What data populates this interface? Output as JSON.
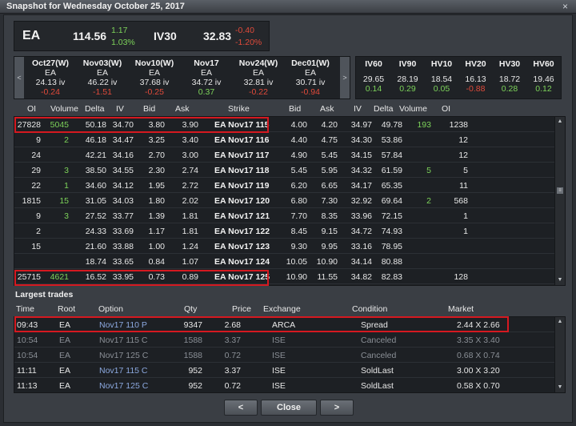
{
  "window": {
    "title": "Snapshot for Wednesday October 25, 2017",
    "close_glyph": "×"
  },
  "quote": {
    "symbol": "EA",
    "price": "114.56",
    "change": "1.17",
    "change_pct": "1.03%",
    "iv_label": "IV30",
    "iv_value": "32.83",
    "iv_change": "-0.40",
    "iv_change_pct": "-1.20%"
  },
  "expirations": {
    "left_arrow": "<",
    "right_arrow": ">",
    "items": [
      {
        "label": "Oct27(W)",
        "root": "EA",
        "iv": "24.13 iv",
        "change": "-0.24",
        "dir": "down"
      },
      {
        "label": "Nov03(W)",
        "root": "EA",
        "iv": "46.22 iv",
        "change": "-1.51",
        "dir": "down"
      },
      {
        "label": "Nov10(W)",
        "root": "EA",
        "iv": "37.68 iv",
        "change": "-0.25",
        "dir": "down"
      },
      {
        "label": "Nov17",
        "root": "EA",
        "iv": "34.72 iv",
        "change": "0.37",
        "dir": "up"
      },
      {
        "label": "Nov24(W)",
        "root": "EA",
        "iv": "32.81 iv",
        "change": "-0.22",
        "dir": "down"
      },
      {
        "label": "Dec01(W)",
        "root": "EA",
        "iv": "30.71 iv",
        "change": "-0.94",
        "dir": "down"
      }
    ]
  },
  "volatility": {
    "items": [
      {
        "label": "IV60",
        "value": "29.65",
        "change": "0.14",
        "dir": "up"
      },
      {
        "label": "IV90",
        "value": "28.19",
        "change": "0.29",
        "dir": "up"
      },
      {
        "label": "HV10",
        "value": "18.54",
        "change": "0.05",
        "dir": "up"
      },
      {
        "label": "HV20",
        "value": "16.13",
        "change": "-0.88",
        "dir": "down"
      },
      {
        "label": "HV30",
        "value": "18.72",
        "change": "0.28",
        "dir": "up"
      },
      {
        "label": "HV60",
        "value": "19.46",
        "change": "0.12",
        "dir": "up"
      }
    ]
  },
  "chain": {
    "headers": {
      "call_oi": "OI",
      "call_volume": "Volume",
      "call_delta": "Delta",
      "call_iv": "IV",
      "call_bid": "Bid",
      "call_ask": "Ask",
      "strike": "Strike",
      "put_bid": "Bid",
      "put_ask": "Ask",
      "put_iv": "IV",
      "put_delta": "Delta",
      "put_volume": "Volume",
      "put_oi": "OI"
    },
    "rows": [
      {
        "c_oi": "27828",
        "c_vol": "5045",
        "c_delta": "50.18",
        "c_iv": "34.70",
        "c_bid": "3.80",
        "c_ask": "3.90",
        "strike": "EA Nov17 115",
        "p_bid": "4.00",
        "p_ask": "4.20",
        "p_iv": "34.97",
        "p_delta": "49.78",
        "p_vol": "193",
        "p_oi": "1238"
      },
      {
        "c_oi": "9",
        "c_vol": "2",
        "c_delta": "46.18",
        "c_iv": "34.47",
        "c_bid": "3.25",
        "c_ask": "3.40",
        "strike": "EA Nov17 116",
        "p_bid": "4.40",
        "p_ask": "4.75",
        "p_iv": "34.30",
        "p_delta": "53.86",
        "p_vol": "",
        "p_oi": "12"
      },
      {
        "c_oi": "24",
        "c_vol": "",
        "c_delta": "42.21",
        "c_iv": "34.16",
        "c_bid": "2.70",
        "c_ask": "3.00",
        "strike": "EA Nov17 117",
        "p_bid": "4.90",
        "p_ask": "5.45",
        "p_iv": "34.15",
        "p_delta": "57.84",
        "p_vol": "",
        "p_oi": "12"
      },
      {
        "c_oi": "29",
        "c_vol": "3",
        "c_delta": "38.50",
        "c_iv": "34.55",
        "c_bid": "2.30",
        "c_ask": "2.74",
        "strike": "EA Nov17 118",
        "p_bid": "5.45",
        "p_ask": "5.95",
        "p_iv": "34.32",
        "p_delta": "61.59",
        "p_vol": "5",
        "p_oi": "5"
      },
      {
        "c_oi": "22",
        "c_vol": "1",
        "c_delta": "34.60",
        "c_iv": "34.12",
        "c_bid": "1.95",
        "c_ask": "2.72",
        "strike": "EA Nov17 119",
        "p_bid": "6.20",
        "p_ask": "6.65",
        "p_iv": "34.17",
        "p_delta": "65.35",
        "p_vol": "",
        "p_oi": "11"
      },
      {
        "c_oi": "1815",
        "c_vol": "15",
        "c_delta": "31.05",
        "c_iv": "34.03",
        "c_bid": "1.80",
        "c_ask": "2.02",
        "strike": "EA Nov17 120",
        "p_bid": "6.80",
        "p_ask": "7.30",
        "p_iv": "32.92",
        "p_delta": "69.64",
        "p_vol": "2",
        "p_oi": "568"
      },
      {
        "c_oi": "9",
        "c_vol": "3",
        "c_delta": "27.52",
        "c_iv": "33.77",
        "c_bid": "1.39",
        "c_ask": "1.81",
        "strike": "EA Nov17 121",
        "p_bid": "7.70",
        "p_ask": "8.35",
        "p_iv": "33.96",
        "p_delta": "72.15",
        "p_vol": "",
        "p_oi": "1"
      },
      {
        "c_oi": "2",
        "c_vol": "",
        "c_delta": "24.33",
        "c_iv": "33.69",
        "c_bid": "1.17",
        "c_ask": "1.81",
        "strike": "EA Nov17 122",
        "p_bid": "8.45",
        "p_ask": "9.15",
        "p_iv": "34.72",
        "p_delta": "74.93",
        "p_vol": "",
        "p_oi": "1"
      },
      {
        "c_oi": "15",
        "c_vol": "",
        "c_delta": "21.60",
        "c_iv": "33.88",
        "c_bid": "1.00",
        "c_ask": "1.24",
        "strike": "EA Nov17 123",
        "p_bid": "9.30",
        "p_ask": "9.95",
        "p_iv": "33.16",
        "p_delta": "78.95",
        "p_vol": "",
        "p_oi": ""
      },
      {
        "c_oi": "",
        "c_vol": "",
        "c_delta": "18.74",
        "c_iv": "33.65",
        "c_bid": "0.84",
        "c_ask": "1.07",
        "strike": "EA Nov17 124",
        "p_bid": "10.05",
        "p_ask": "10.90",
        "p_iv": "34.14",
        "p_delta": "80.88",
        "p_vol": "",
        "p_oi": ""
      },
      {
        "c_oi": "25715",
        "c_vol": "4621",
        "c_delta": "16.52",
        "c_iv": "33.95",
        "c_bid": "0.73",
        "c_ask": "0.89",
        "strike": "EA Nov17 125",
        "p_bid": "10.90",
        "p_ask": "11.55",
        "p_iv": "34.82",
        "p_delta": "82.83",
        "p_vol": "",
        "p_oi": "128"
      }
    ]
  },
  "trades": {
    "section_title": "Largest trades",
    "headers": {
      "time": "Time",
      "root": "Root",
      "option": "Option",
      "qty": "Qty",
      "price": "Price",
      "exchange": "Exchange",
      "condition": "Condition",
      "market": "Market"
    },
    "rows": [
      {
        "time": "09:43",
        "root": "EA",
        "option": "Nov17 110 P",
        "qty": "9347",
        "price": "2.68",
        "exchange": "ARCA",
        "condition": "Spread",
        "market": "2.44 X 2.66",
        "dim": false
      },
      {
        "time": "10:54",
        "root": "EA",
        "option": "Nov17 115 C",
        "qty": "1588",
        "price": "3.37",
        "exchange": "ISE",
        "condition": "Canceled",
        "market": "3.35 X 3.40",
        "dim": true
      },
      {
        "time": "10:54",
        "root": "EA",
        "option": "Nov17 125 C",
        "qty": "1588",
        "price": "0.72",
        "exchange": "ISE",
        "condition": "Canceled",
        "market": "0.68 X 0.74",
        "dim": true
      },
      {
        "time": "11:11",
        "root": "EA",
        "option": "Nov17 115 C",
        "qty": "952",
        "price": "3.37",
        "exchange": "ISE",
        "condition": "SoldLast",
        "market": "3.00 X 3.20",
        "dim": false
      },
      {
        "time": "11:13",
        "root": "EA",
        "option": "Nov17 125 C",
        "qty": "952",
        "price": "0.72",
        "exchange": "ISE",
        "condition": "SoldLast",
        "market": "0.58 X 0.70",
        "dim": false
      }
    ]
  },
  "buttons": {
    "prev": "<",
    "close": "Close",
    "next": ">"
  },
  "colors": {
    "up": "#7dd35a",
    "down": "#e04a3a",
    "highlight": "#d51920",
    "option_link": "#8ca9e0"
  }
}
